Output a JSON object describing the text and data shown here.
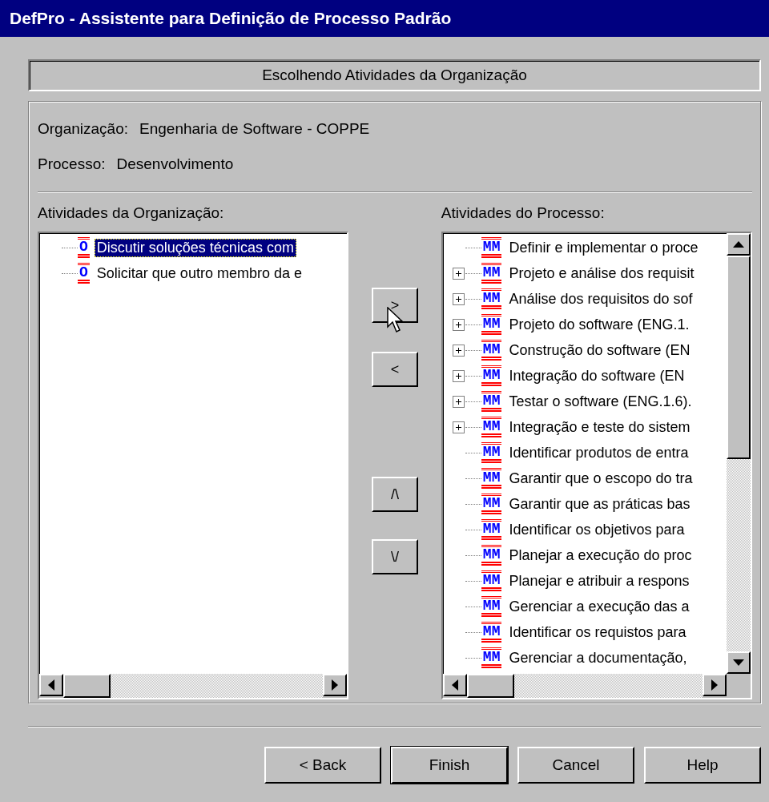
{
  "window": {
    "title": "DefPro - Assistente para Definição de Processo Padrão"
  },
  "step_title": "Escolhendo Atividades da Organização",
  "info": [
    {
      "label": "Organização:",
      "value": "Engenharia de Software - COPPE"
    },
    {
      "label": "Processo:",
      "value": "Desenvolvimento"
    }
  ],
  "left_list": {
    "label": "Atividades da Organização:",
    "items": [
      {
        "badge": "O",
        "text": "Discutir soluções técnicas com",
        "expandable": false,
        "selected": true
      },
      {
        "badge": "O",
        "text": "Solicitar que outro membro da e",
        "expandable": false,
        "selected": false
      }
    ]
  },
  "move_buttons": [
    {
      "label": ">",
      "kind": "add"
    },
    {
      "label": "<",
      "kind": "remove"
    },
    {
      "label": "/\\",
      "kind": "up"
    },
    {
      "label": "\\/",
      "kind": "down"
    }
  ],
  "right_list": {
    "label": "Atividades do Processo:",
    "items": [
      {
        "badge": "MM",
        "text": "Definir e implementar o proce",
        "expandable": false,
        "selected": false
      },
      {
        "badge": "MM",
        "text": "Projeto e análise dos requisit",
        "expandable": true,
        "selected": false
      },
      {
        "badge": "MM",
        "text": "Análise dos requisitos do sof",
        "expandable": true,
        "selected": false
      },
      {
        "badge": "MM",
        "text": "Projeto do software (ENG.1.",
        "expandable": true,
        "selected": false
      },
      {
        "badge": "MM",
        "text": "Construção do software (EN",
        "expandable": true,
        "selected": false
      },
      {
        "badge": "MM",
        "text": "Integração do software (EN",
        "expandable": true,
        "selected": false
      },
      {
        "badge": "MM",
        "text": "Testar o software (ENG.1.6).",
        "expandable": true,
        "selected": false
      },
      {
        "badge": "MM",
        "text": "Integração e teste do sistem",
        "expandable": true,
        "selected": false
      },
      {
        "badge": "MM",
        "text": "Identificar produtos de entra",
        "expandable": false,
        "selected": false
      },
      {
        "badge": "MM",
        "text": "Garantir que o escopo do tra",
        "expandable": false,
        "selected": false
      },
      {
        "badge": "MM",
        "text": "Garantir que as práticas bas",
        "expandable": false,
        "selected": false
      },
      {
        "badge": "MM",
        "text": "Identificar os objetivos para",
        "expandable": false,
        "selected": false
      },
      {
        "badge": "MM",
        "text": "Planejar a execução do proc",
        "expandable": false,
        "selected": false
      },
      {
        "badge": "MM",
        "text": "Planejar e atribuir a respons",
        "expandable": false,
        "selected": false
      },
      {
        "badge": "MM",
        "text": "Gerenciar a execução das a",
        "expandable": false,
        "selected": false
      },
      {
        "badge": "MM",
        "text": "Identificar os requistos para",
        "expandable": false,
        "selected": false
      },
      {
        "badge": "MM",
        "text": "Gerenciar a documentação,",
        "expandable": false,
        "selected": false
      }
    ]
  },
  "buttons": [
    {
      "label": "< Back",
      "default": false
    },
    {
      "label": "Finish",
      "default": true
    },
    {
      "label": "Cancel",
      "default": false
    },
    {
      "label": "Help",
      "default": false
    }
  ]
}
